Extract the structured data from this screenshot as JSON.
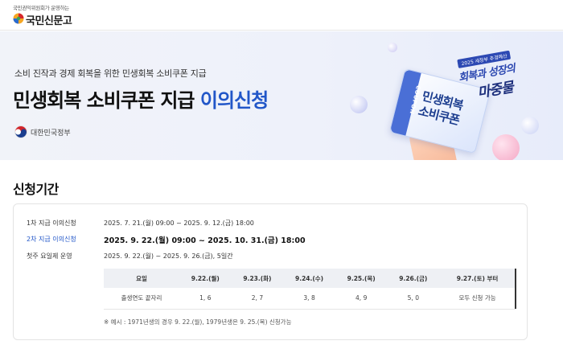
{
  "header": {
    "logo_tagline": "국민권익위원회가 운영하는",
    "logo_name": "국민신문고"
  },
  "banner": {
    "subtitle": "소비 진작과 경제 회복을 위한 민생회복 소비쿠폰 지급",
    "title_main": "민생회복 소비쿠폰 지급",
    "title_highlight": "이의신청",
    "gov_label": "대한민국정부",
    "coupon_tag": "COUPON",
    "coupon_line1": "민생회복",
    "coupon_line2": "소비쿠폰",
    "slogan_badge": "2025 새정부 추경예산",
    "slogan_line1": "회복과 성장의",
    "slogan_line2": "마중물"
  },
  "section": {
    "title": "신청기간",
    "rows": [
      {
        "label": "1차 지급 이의신청",
        "value": "2025. 7. 21.(월) 09:00 ~ 2025. 9. 12.(금) 18:00"
      },
      {
        "label": "2차 지급 이의신청",
        "value": "2025. 9. 22.(월) 09:00 ~ 2025. 10. 31.(금) 18:00"
      },
      {
        "label": "첫주 요일제 운영",
        "value": "2025. 9. 22.(월) ~ 2025. 9. 26.(금), 5일간"
      }
    ],
    "table": {
      "headers": [
        "요일",
        "9.22.(월)",
        "9.23.(화)",
        "9.24.(수)",
        "9.25.(목)",
        "9.26.(금)",
        "9.27.(토) 부터"
      ],
      "row": [
        "출생연도 끝자리",
        "1, 6",
        "2, 7",
        "3, 8",
        "4, 9",
        "5, 0",
        "모두 신청 가능"
      ]
    },
    "note": "※ 예시 : 1971년생의 경우 9. 22.(월), 1979년생은 9. 25.(목) 신청가능"
  },
  "colors": {
    "accent": "#2156c8",
    "table_header_bg": "#eef0f4"
  }
}
